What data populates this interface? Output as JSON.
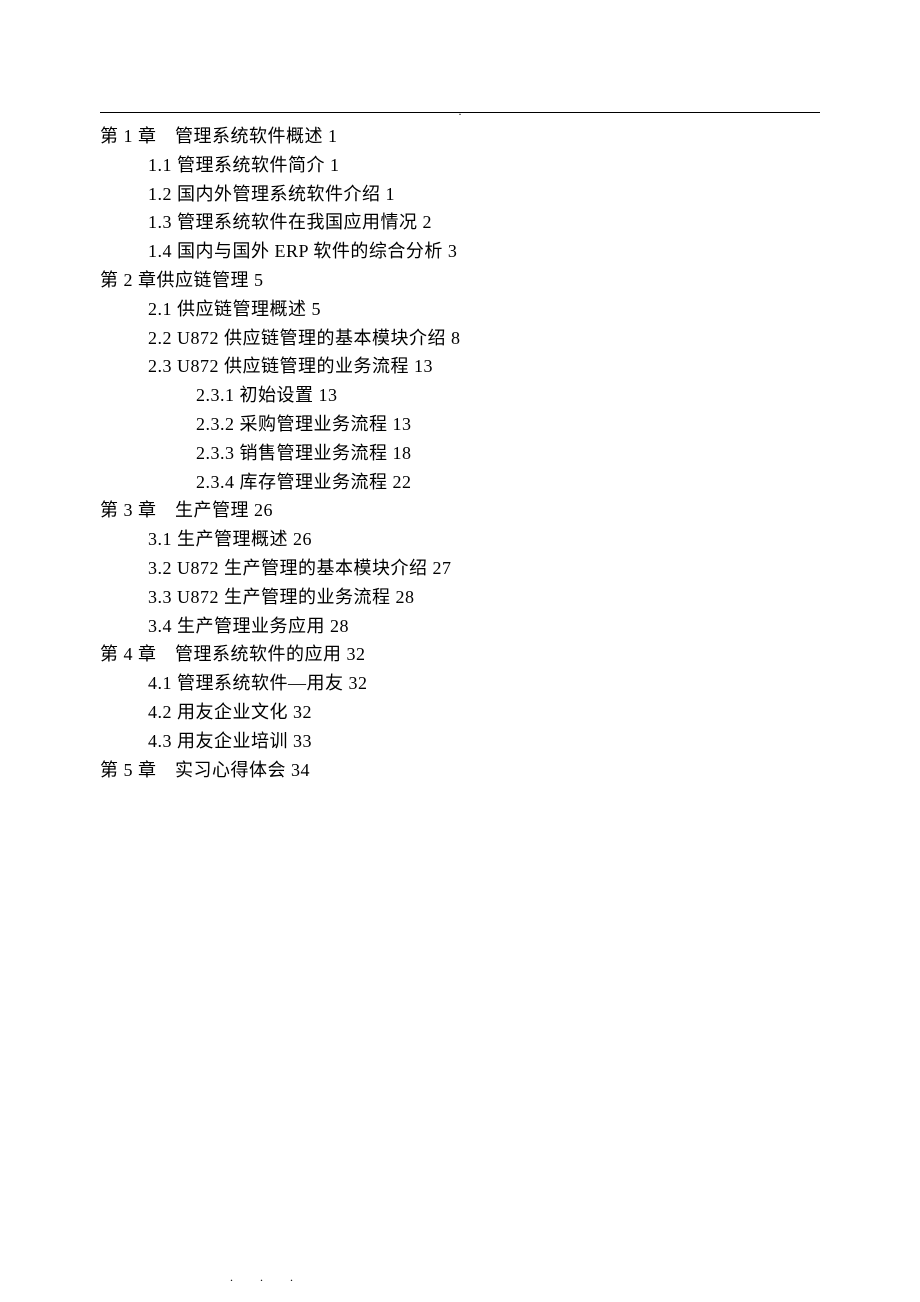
{
  "header_dot": ".",
  "footer_dots": ". . .",
  "toc": [
    {
      "level": 1,
      "text": "第 1 章　管理系统软件概述 1"
    },
    {
      "level": 2,
      "text": "1.1 管理系统软件简介 1"
    },
    {
      "level": 2,
      "text": "1.2 国内外管理系统软件介绍 1"
    },
    {
      "level": 2,
      "text": "1.3 管理系统软件在我国应用情况 2"
    },
    {
      "level": 2,
      "text": "1.4 国内与国外 ERP 软件的综合分析 3"
    },
    {
      "level": 1,
      "text": "第 2 章供应链管理 5"
    },
    {
      "level": 2,
      "text": "2.1 供应链管理概述 5"
    },
    {
      "level": 2,
      "text": "2.2 U872 供应链管理的基本模块介绍 8"
    },
    {
      "level": 2,
      "text": "2.3 U872 供应链管理的业务流程 13"
    },
    {
      "level": 3,
      "text": "2.3.1 初始设置 13"
    },
    {
      "level": 3,
      "text": "2.3.2 采购管理业务流程 13"
    },
    {
      "level": 3,
      "text": "2.3.3 销售管理业务流程 18"
    },
    {
      "level": 3,
      "text": "2.3.4 库存管理业务流程 22"
    },
    {
      "level": 1,
      "text": "第 3 章　生产管理 26"
    },
    {
      "level": 2,
      "text": "3.1 生产管理概述 26"
    },
    {
      "level": 2,
      "text": "3.2 U872 生产管理的基本模块介绍 27"
    },
    {
      "level": 2,
      "text": "3.3 U872 生产管理的业务流程 28"
    },
    {
      "level": 2,
      "text": "3.4 生产管理业务应用 28"
    },
    {
      "level": 1,
      "text": "第 4 章　管理系统软件的应用 32"
    },
    {
      "level": 2,
      "text": "4.1 管理系统软件—用友 32"
    },
    {
      "level": 2,
      "text": "4.2 用友企业文化 32"
    },
    {
      "level": 2,
      "text": "4.3 用友企业培训 33"
    },
    {
      "level": 1,
      "text": "第 5 章　实习心得体会 34"
    }
  ]
}
